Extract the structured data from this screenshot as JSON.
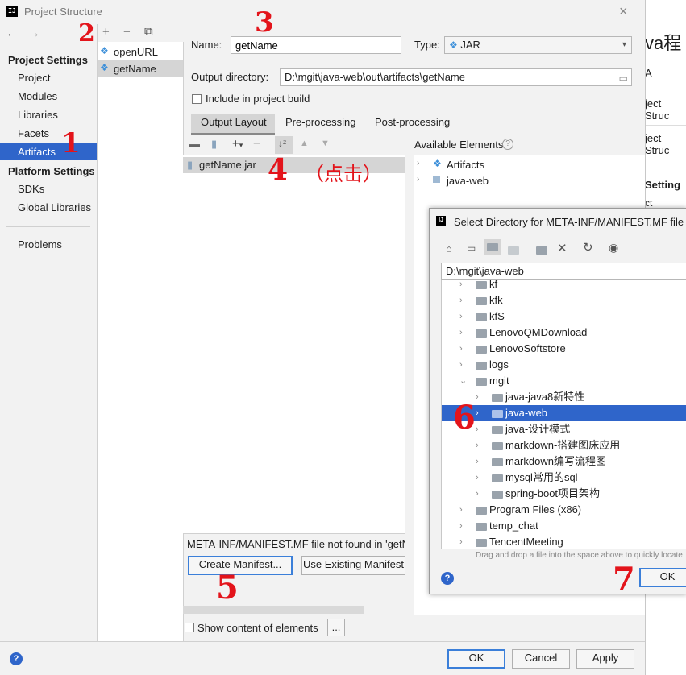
{
  "window": {
    "title": "Project Structure",
    "close_glyph": "×",
    "logo_text": "IJ"
  },
  "left_nav": {
    "back_glyph": "←",
    "forward_glyph": "→",
    "project_settings_header": "Project Settings",
    "project_items": [
      "Project",
      "Modules",
      "Libraries",
      "Facets",
      "Artifacts"
    ],
    "selected_item": "Artifacts",
    "platform_settings_header": "Platform Settings",
    "platform_items": [
      "SDKs",
      "Global Libraries"
    ],
    "problems": "Problems"
  },
  "artifact_list": {
    "toolbar": [
      "+",
      "−",
      "⧉"
    ],
    "items": [
      "openURL",
      "getName"
    ],
    "selected": "getName"
  },
  "form": {
    "name_label": "Name:",
    "name_value": "getName",
    "type_label": "Type:",
    "type_value": "JAR",
    "output_dir_label": "Output directory:",
    "output_dir_value": "D:\\mgit\\java-web\\out\\artifacts\\getName",
    "include_label": "Include in project build"
  },
  "tabs": [
    "Output Layout",
    "Pre-processing",
    "Post-processing"
  ],
  "selected_tab": "Output Layout",
  "layout": {
    "root_item": "getName.jar",
    "available_label": "Available Elements",
    "available_items": [
      "Artifacts",
      "java-web"
    ],
    "manifest_message": "META-INF/MANIFEST.MF file not found in 'getNa",
    "create_manifest_button": "Create Manifest...",
    "use_existing_button": "Use Existing Manifest",
    "show_content_label": "Show content of elements",
    "ellipsis_button": "..."
  },
  "footer": {
    "help": "?",
    "ok": "OK",
    "cancel": "Cancel",
    "apply": "Apply"
  },
  "background_right": {
    "fragments": [
      "va程",
      "A",
      "ject Struc",
      "ject Struc",
      "Setting",
      "ct"
    ]
  },
  "dialog": {
    "title": "Select Directory for META-INF/MANIFEST.MF file",
    "path_value": "D:\\mgit\\java-web",
    "rows": [
      {
        "label": "kf",
        "indent": 0,
        "expanded": false
      },
      {
        "label": "kfk",
        "indent": 0,
        "expanded": false
      },
      {
        "label": "kfS",
        "indent": 0,
        "expanded": false
      },
      {
        "label": "LenovoQMDownload",
        "indent": 0,
        "expanded": false
      },
      {
        "label": "LenovoSoftstore",
        "indent": 0,
        "expanded": false
      },
      {
        "label": "logs",
        "indent": 0,
        "expanded": false
      },
      {
        "label": "mgit",
        "indent": 0,
        "expanded": true
      },
      {
        "label": "java-java8新特性",
        "indent": 1,
        "expanded": false
      },
      {
        "label": "java-web",
        "indent": 1,
        "expanded": false
      },
      {
        "label": "java-设计模式",
        "indent": 1,
        "expanded": false
      },
      {
        "label": "markdown-搭建图床应用",
        "indent": 1,
        "expanded": false
      },
      {
        "label": "markdown编写流程图",
        "indent": 1,
        "expanded": false
      },
      {
        "label": "mysql常用的sql",
        "indent": 1,
        "expanded": false
      },
      {
        "label": "spring-boot项目架构",
        "indent": 1,
        "expanded": false
      },
      {
        "label": "Program Files (x86)",
        "indent": 0,
        "expanded": false
      },
      {
        "label": "temp_chat",
        "indent": 0,
        "expanded": false
      },
      {
        "label": "TencentMeeting",
        "indent": 0,
        "expanded": false
      }
    ],
    "selected_row": "java-web",
    "hint": "Drag and drop a file into the space above to quickly locate",
    "help": "?",
    "ok": "OK"
  },
  "annotations": {
    "n1": "1",
    "n2": "2",
    "n3": "3",
    "n4": "4",
    "n4_text": "（点击）",
    "n5": "5",
    "n6": "6",
    "n7": "7",
    "color": "#e3141b"
  },
  "colors": {
    "selection": "#2f65ca",
    "accent": "#3b7fd9"
  }
}
